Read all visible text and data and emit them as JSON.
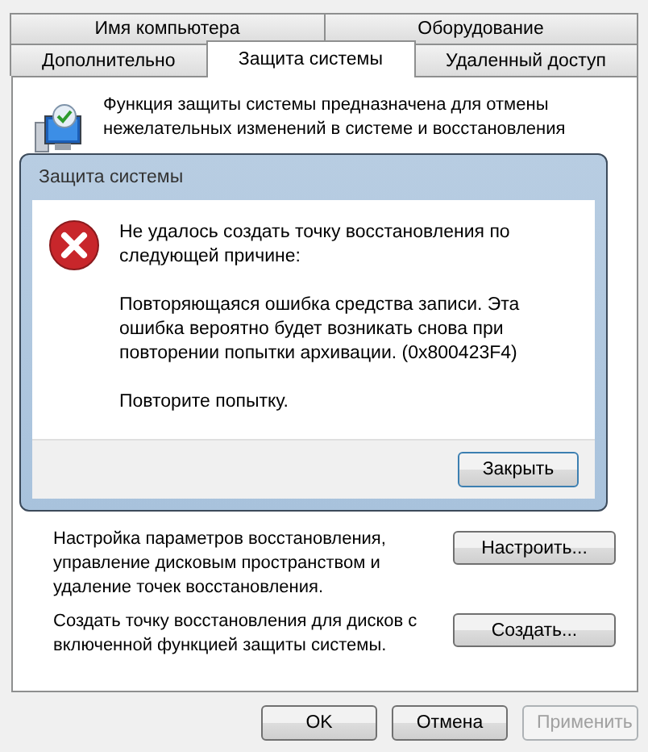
{
  "tab_rows": [
    {
      "tabs": [
        {
          "label": "Имя компьютера",
          "selected": false
        },
        {
          "label": "Оборудование",
          "selected": false
        }
      ]
    },
    {
      "tabs": [
        {
          "label": "Дополнительно",
          "selected": false
        },
        {
          "label": "Защита системы",
          "selected": true
        },
        {
          "label": "Удаленный доступ",
          "selected": false
        }
      ]
    }
  ],
  "intro": {
    "text": "Функция защиты системы предназначена для отмены нежелательных изменений в системе и восстановления"
  },
  "actions": [
    {
      "text": "Настройка параметров восстановления, управление дисковым пространством и удаление точек восстановления.",
      "button": "Настроить..."
    },
    {
      "text": "Создать точку восстановления для дисков с включенной функцией защиты системы.",
      "button": "Создать..."
    }
  ],
  "dialog": {
    "title": "Защита системы",
    "message": "Не удалось создать точку восстановления по следующей причине:",
    "detail": "Повторяющаяся ошибка средства записи.  Эта ошибка вероятно будет возникать снова при повторении попытки архивации. (0x800423F4)",
    "retry": "Повторите попытку.",
    "button": "Закрыть"
  },
  "buttons": [
    {
      "label": "OK",
      "disabled": false
    },
    {
      "label": "Отмена",
      "disabled": false
    },
    {
      "label": "Применить",
      "disabled": true
    }
  ]
}
